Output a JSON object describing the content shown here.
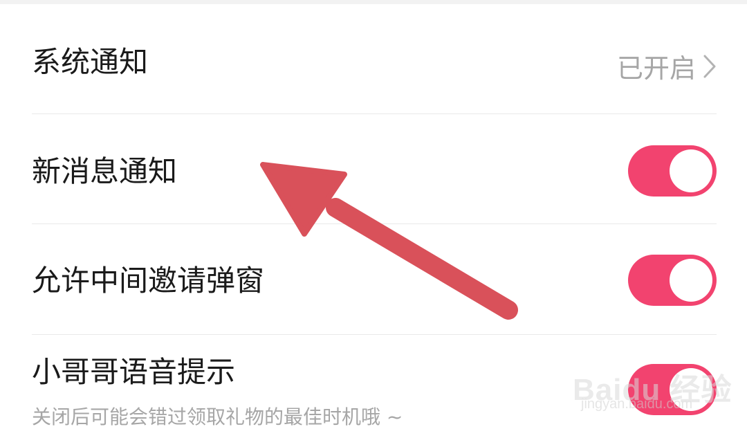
{
  "settings": {
    "items": [
      {
        "label": "系统通知",
        "status": "已开启",
        "type": "link"
      },
      {
        "label": "新消息通知",
        "type": "toggle",
        "enabled": true
      },
      {
        "label": "允许中间邀请弹窗",
        "type": "toggle",
        "enabled": true
      },
      {
        "label": "小哥哥语音提示",
        "description": "关闭后可能会错过领取礼物的最佳时机哦 ~",
        "type": "toggle",
        "enabled": true
      }
    ]
  },
  "watermark": {
    "brand": "Baidu 经验",
    "url": "jingyan.baidu.com"
  },
  "colors": {
    "toggle_on": "#f2436f",
    "arrow": "#d9515a",
    "secondary_text": "#a6a6a6"
  },
  "icons": {
    "chevron": "chevron-right-icon",
    "arrow": "annotation-arrow-icon"
  }
}
